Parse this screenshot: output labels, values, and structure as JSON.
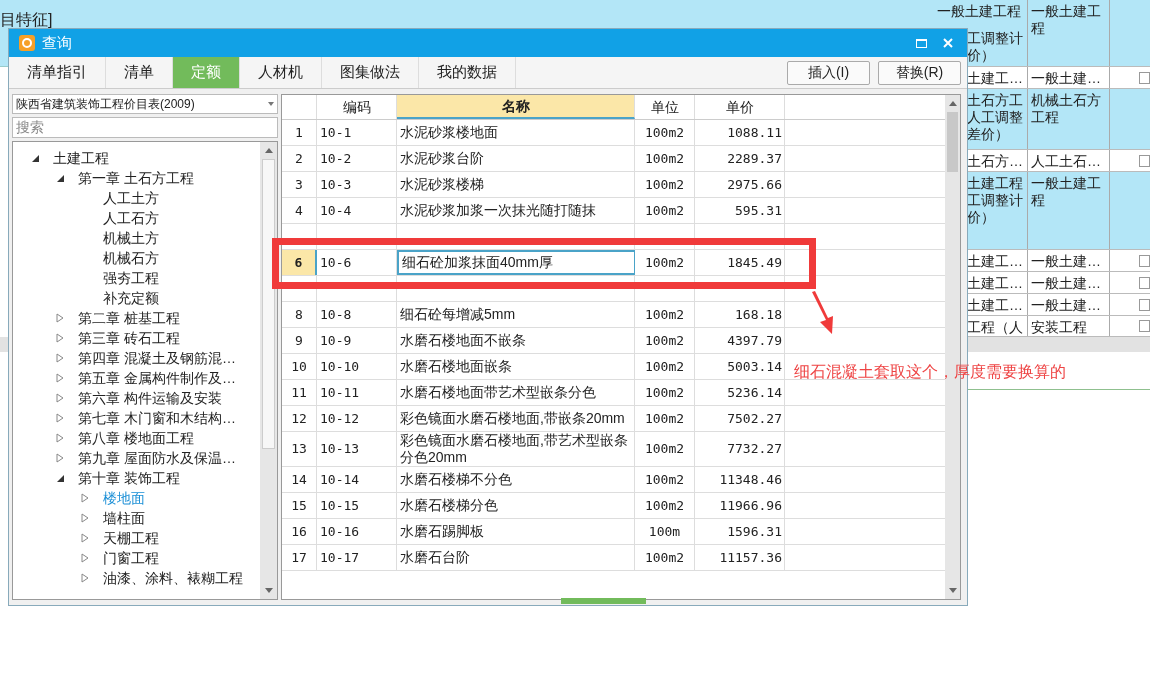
{
  "background": {
    "top_left_text": "目特征]",
    "rows": [
      {
        "highlighted": true,
        "first_line_clear": true,
        "a": "一般土建工程",
        "a_more": [
          "工调整计",
          "价）"
        ],
        "b": "一般土建工程"
      },
      {
        "highlighted": false,
        "a": "土建工…",
        "b": "一般土建…",
        "checked": false
      },
      {
        "highlighted": true,
        "a": "土石方工",
        "a_more": [
          "人工调整",
          "差价）"
        ],
        "b": "机械土石方工程"
      },
      {
        "highlighted": false,
        "a": "土石方…",
        "b": "人工土石…",
        "checked": false
      },
      {
        "highlighted": true,
        "a": "土建工程",
        "a_more": [
          "工调整计",
          "价）"
        ],
        "b": "一般土建工程"
      },
      {
        "highlighted": false,
        "a": "土建工…",
        "b": "一般土建…",
        "checked": false
      },
      {
        "highlighted": false,
        "a": "土建工…",
        "b": "一般土建…",
        "checked": false
      },
      {
        "highlighted": false,
        "a": "土建工…",
        "b": "一般土建…",
        "checked": false
      },
      {
        "highlighted": false,
        "a": "工程（人",
        "b": "安装工程",
        "checked": false
      }
    ]
  },
  "dialog": {
    "title": "查询",
    "tabs": [
      {
        "label": "清单指引",
        "selected": false
      },
      {
        "label": "清单",
        "selected": false
      },
      {
        "label": "定额",
        "selected": true
      },
      {
        "label": "人材机",
        "selected": false
      },
      {
        "label": "图集做法",
        "selected": false
      },
      {
        "label": "我的数据",
        "selected": false
      }
    ],
    "buttons": [
      "插入(I)",
      "替换(R)"
    ],
    "library_select": "陕西省建筑装饰工程价目表(2009)",
    "search": {
      "placeholder": "搜索"
    },
    "tree": [
      {
        "label": "土建工程",
        "expanded": true,
        "selected": false,
        "children": [
          {
            "label": "第一章  土石方工程",
            "expanded": true,
            "selected": false,
            "children": [
              {
                "label": "人工土方",
                "selected": false
              },
              {
                "label": "人工石方",
                "selected": false
              },
              {
                "label": "机械土方",
                "selected": false
              },
              {
                "label": "机械石方",
                "selected": false
              },
              {
                "label": "强夯工程",
                "selected": false
              },
              {
                "label": "补充定额",
                "selected": false
              }
            ]
          },
          {
            "label": "第二章  桩基工程",
            "expanded": false,
            "selected": false
          },
          {
            "label": "第三章  砖石工程",
            "expanded": false,
            "selected": false
          },
          {
            "label": "第四章  混凝土及钢筋混…",
            "expanded": false,
            "selected": false
          },
          {
            "label": "第五章  金属构件制作及…",
            "expanded": false,
            "selected": false
          },
          {
            "label": "第六章  构件运输及安装",
            "expanded": false,
            "selected": false
          },
          {
            "label": "第七章  木门窗和木结构…",
            "expanded": false,
            "selected": false
          },
          {
            "label": "第八章  楼地面工程",
            "expanded": false,
            "selected": false
          },
          {
            "label": "第九章  屋面防水及保温…",
            "expanded": false,
            "selected": false
          },
          {
            "label": "第十章  装饰工程",
            "expanded": true,
            "selected": false,
            "children": [
              {
                "label": "楼地面",
                "expanded": false,
                "selected": true
              },
              {
                "label": "墙柱面",
                "expanded": false,
                "selected": false
              },
              {
                "label": "天棚工程",
                "expanded": false,
                "selected": false
              },
              {
                "label": "门窗工程",
                "expanded": false,
                "selected": false
              },
              {
                "label": "油漆、涂料、裱糊工程",
                "expanded": false,
                "selected": false
              }
            ]
          }
        ]
      }
    ],
    "table": {
      "columns": [
        {
          "label": "编码",
          "current": false
        },
        {
          "label": "名称",
          "current": true
        },
        {
          "label": "单位",
          "current": false
        },
        {
          "label": "单价",
          "current": false
        }
      ],
      "rows": [
        {
          "num": "1",
          "code": "10-1",
          "name": "水泥砂浆楼地面",
          "unit": "100m2",
          "price": "1088.11",
          "selected": false
        },
        {
          "num": "2",
          "code": "10-2",
          "name": "水泥砂浆台阶",
          "unit": "100m2",
          "price": "2289.37",
          "selected": false
        },
        {
          "num": "3",
          "code": "10-3",
          "name": "水泥砂浆楼梯",
          "unit": "100m2",
          "price": "2975.66",
          "selected": false
        },
        {
          "num": "4",
          "code": "10-4",
          "name": "水泥砂浆加浆一次抹光随打随抹",
          "unit": "100m2",
          "price": "595.31",
          "selected": false
        },
        {
          "selected": false
        },
        {
          "num": "6",
          "code": "10-6",
          "name": "细石砼加浆抹面40mm厚",
          "unit": "100m2",
          "price": "1845.49",
          "selected": true
        },
        {
          "selected": false
        },
        {
          "num": "8",
          "code": "10-8",
          "name": "细石砼每增减5mm",
          "unit": "100m2",
          "price": "168.18",
          "selected": false
        },
        {
          "num": "9",
          "code": "10-9",
          "name": "水磨石楼地面不嵌条",
          "unit": "100m2",
          "price": "4397.79",
          "selected": false
        },
        {
          "num": "10",
          "code": "10-10",
          "name": "水磨石楼地面嵌条",
          "unit": "100m2",
          "price": "5003.14",
          "selected": false
        },
        {
          "num": "11",
          "code": "10-11",
          "name": "水磨石楼地面带艺术型嵌条分色",
          "unit": "100m2",
          "price": "5236.14",
          "selected": false
        },
        {
          "num": "12",
          "code": "10-12",
          "name": "彩色镜面水磨石楼地面,带嵌条20mm",
          "unit": "100m2",
          "price": "7502.27",
          "selected": false
        },
        {
          "num": "13",
          "code": "10-13",
          "name": "彩色镜面水磨石楼地面,带艺术型嵌条分色20mm",
          "unit": "100m2",
          "price": "7732.27",
          "selected": false
        },
        {
          "num": "14",
          "code": "10-14",
          "name": "水磨石楼梯不分色",
          "unit": "100m2",
          "price": "11348.46",
          "selected": false
        },
        {
          "num": "15",
          "code": "10-15",
          "name": "水磨石楼梯分色",
          "unit": "100m2",
          "price": "11966.96",
          "selected": false
        },
        {
          "num": "16",
          "code": "10-16",
          "name": "水磨石踢脚板",
          "unit": "100m",
          "price": "1596.31",
          "selected": false
        },
        {
          "num": "17",
          "code": "10-17",
          "name": "水磨石台阶",
          "unit": "100m2",
          "price": "11157.36",
          "selected": false
        }
      ]
    }
  },
  "annotation": {
    "text": "细石混凝土套取这个，厚度需要换算的"
  }
}
